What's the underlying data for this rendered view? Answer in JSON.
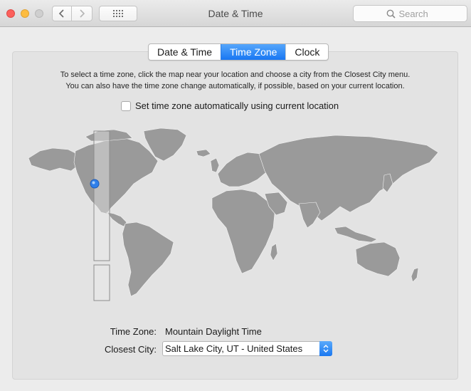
{
  "window": {
    "title": "Date & Time"
  },
  "search": {
    "placeholder": "Search"
  },
  "tabs": [
    {
      "label": "Date & Time",
      "active": false
    },
    {
      "label": "Time Zone",
      "active": true
    },
    {
      "label": "Clock",
      "active": false
    }
  ],
  "instructions": {
    "line1": "To select a time zone, click the map near your location and choose a city from the Closest City menu.",
    "line2": "You can also have the time zone change automatically, if possible, based on your current location."
  },
  "auto_timezone": {
    "label": "Set time zone automatically using current location",
    "checked": false
  },
  "timezone": {
    "label": "Time Zone:",
    "value": "Mountain Daylight Time"
  },
  "closest_city": {
    "label": "Closest City:",
    "value": "Salt Lake City, UT - United States"
  },
  "colors": {
    "accent": "#1877f3",
    "land": "#9a9a9a",
    "map_bg": "#e3e3e3"
  },
  "icons": [
    "chevron-left-icon",
    "chevron-right-icon",
    "grid-icon",
    "search-icon",
    "location-pin-icon",
    "updown-chevron-icon"
  ]
}
